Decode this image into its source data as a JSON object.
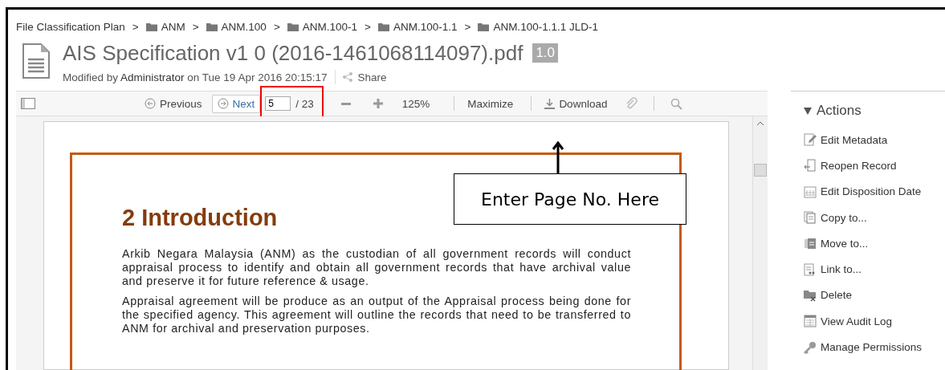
{
  "breadcrumb": [
    {
      "label": "File Classification Plan",
      "kind": "root"
    },
    {
      "separator": ">",
      "label": "ANM",
      "kind": "folder"
    },
    {
      "separator": ">",
      "label": "ANM.100",
      "kind": "folder"
    },
    {
      "separator": ">",
      "label": "ANM.100-1",
      "kind": "folder"
    },
    {
      "separator": ">",
      "label": "ANM.100-1.1",
      "kind": "folder"
    },
    {
      "separator": ">",
      "label": "ANM.100-1.1.1 JLD-1",
      "kind": "folder"
    }
  ],
  "document": {
    "title": "AIS Specification v1 0 (2016-1461068114097).pdf",
    "version": "1.0",
    "modified": "Modified by **Administrator** on Tue 19 Apr 2016 20:15:17",
    "share": "Share"
  },
  "toolbar": {
    "previous": "Previous",
    "next": "Next",
    "page": "5",
    "page_total": "/ 23",
    "zoom": "125%",
    "maximize": "Maximize",
    "download": "Download"
  },
  "page": {
    "heading": "2 Introduction",
    "paragraphs": [
      "Arkib Negara Malaysia (ANM) as the custodian of all government records will conduct appraisal process to identify and obtain all government records that have archival value and preserve it for future reference & usage.",
      "Appraisal agreement will be produce as an output of the Appraisal process being done for the specified agency. This agreement will outline the records that need to be transferred to ANM for archival and preservation purposes."
    ]
  },
  "callout": {
    "text": "Enter Page No. Here"
  },
  "actions": {
    "title": "Actions",
    "expanded": true,
    "items": [
      {
        "label": "Edit Metadata",
        "kind": "edit"
      },
      {
        "label": "Reopen Record",
        "kind": "reopen"
      },
      {
        "label": "Edit Disposition Date",
        "kind": "calendar"
      },
      {
        "label": "Copy to...",
        "kind": "copy"
      },
      {
        "label": "Move to...",
        "kind": "move"
      },
      {
        "label": "Link to...",
        "kind": "link"
      },
      {
        "label": "Delete",
        "kind": "delete"
      },
      {
        "label": "View Audit Log",
        "kind": "log"
      },
      {
        "label": "Manage Permissions",
        "kind": "key"
      }
    ]
  }
}
